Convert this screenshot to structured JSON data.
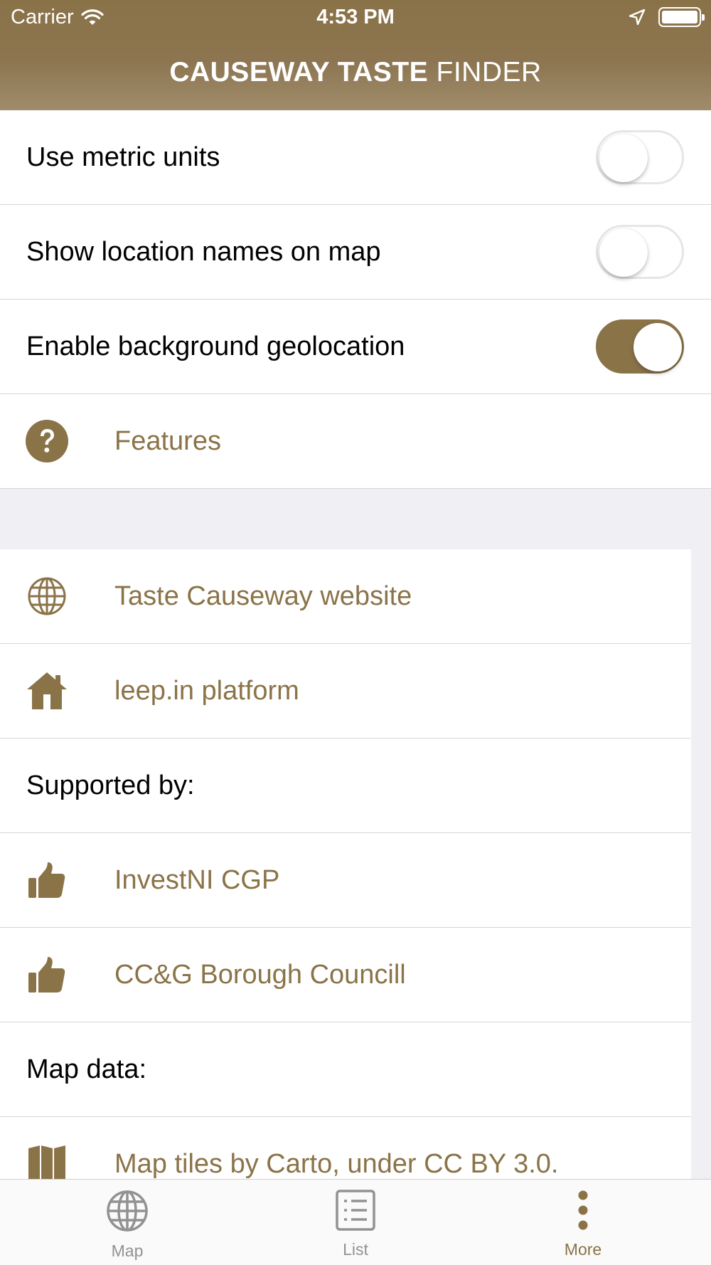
{
  "status_bar": {
    "carrier": "Carrier",
    "time": "4:53 PM"
  },
  "header": {
    "title_bold": "CAUSEWAY TASTE",
    "title_light": "FINDER"
  },
  "settings": {
    "metric_units": {
      "label": "Use metric units",
      "enabled": false
    },
    "location_names": {
      "label": "Show location names on map",
      "enabled": false
    },
    "background_geolocation": {
      "label": "Enable background geolocation",
      "enabled": true
    },
    "features": {
      "label": "Features",
      "icon": "question-circle-icon"
    }
  },
  "links": {
    "website": {
      "label": "Taste Causeway website",
      "icon": "globe-icon"
    },
    "platform": {
      "label": "leep.in platform",
      "icon": "home-icon"
    },
    "supported_by": "Supported by:",
    "investni": {
      "label": "InvestNI CGP",
      "icon": "thumbs-up-icon"
    },
    "council": {
      "label": "CC&G Borough Councill",
      "icon": "thumbs-up-icon"
    },
    "map_data": "Map data:",
    "map_tiles": {
      "label": "Map tiles by Carto, under CC BY 3.0.",
      "icon": "map-icon"
    }
  },
  "tabs": [
    {
      "label": "Map",
      "icon": "globe-icon"
    },
    {
      "label": "List",
      "icon": "list-icon"
    },
    {
      "label": "More",
      "icon": "more-vertical-icon"
    }
  ],
  "colors": {
    "accent": "#8b7348",
    "separator": "#d6d6da",
    "group_background": "#efeff4"
  }
}
